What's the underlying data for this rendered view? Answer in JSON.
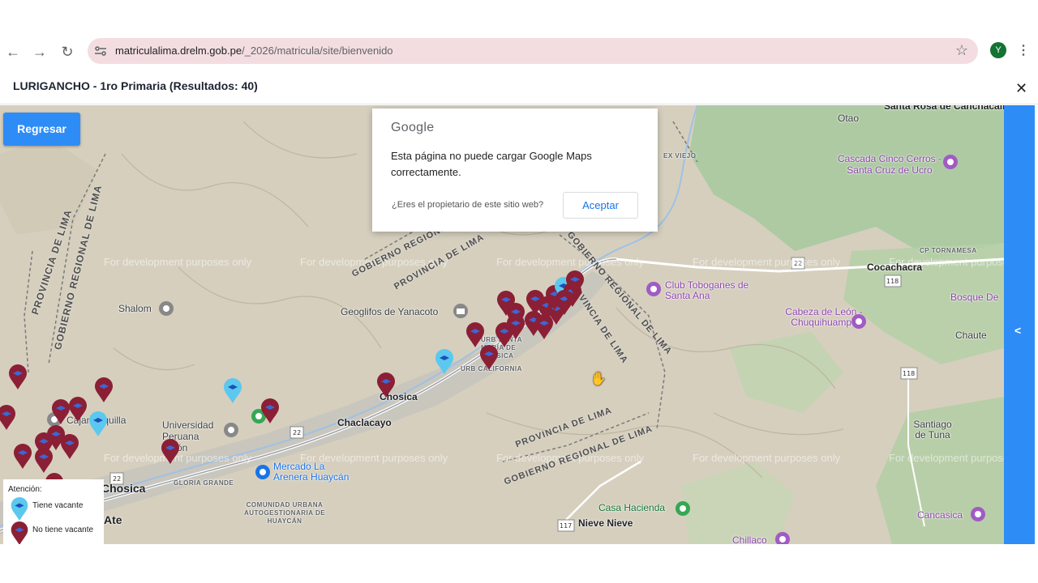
{
  "browser": {
    "url_domain": "matriculalima.drelm.gob.pe",
    "url_path": "/_2026/matricula/site/bienvenido",
    "avatar_letter": "Y"
  },
  "modal": {
    "title": "LURIGANCHO - 1ro Primaria (Resultados: 40)",
    "close_symbol": "✕"
  },
  "map": {
    "back_button": "Regresar",
    "side_toggle": "<",
    "watermark": "For development purposes only",
    "google_dialog": {
      "logo": "Google",
      "message": "Esta página no puede cargar Google Maps correctamente.",
      "owner_question": "¿Eres el propietario de este sitio web?",
      "accept_button": "Aceptar"
    },
    "legend": {
      "title": "Atención:",
      "vacancy": "Tiene vacante",
      "no_vacancy": "No tiene vacante"
    },
    "labels": {
      "santa_rosa": "Santa Rosa de Canchacalla",
      "otao": "Otao",
      "cascada": "Cascada Cinco Cerros - Santa Cruz de Ucro",
      "club_toboganes": "Club Toboganes de Santa Ana",
      "cocachacra": "Cocachacra",
      "cp_tornamesa": "CP TORNAMESA",
      "bosque": "Bosque De",
      "cabeza_leon": "Cabeza de León - Chuquihuampo",
      "chaute": "Chaute",
      "santiago_tuna": "Santiago de Tuna",
      "shalom": "Shalom",
      "geoglifos": "Geoglifos de Yanacoto",
      "chosica_center": "Chosica",
      "chaclacayo": "Chaclacayo",
      "universidad": "Universidad Peruana Unión",
      "cajamarquilla": "Cajamarquilla",
      "mercado": "Mercado La Arenera Huaycán",
      "chosica_left": "Chosica",
      "ate": "Ate",
      "gloria_grande": "GLORIA GRANDE",
      "comunidad": "COMUNIDAD URBANA AUTOGESTIONARIA DE HUAYCÁN",
      "casa_hacienda": "Casa Hacienda",
      "nieve_nieve": "Nieve Nieve",
      "cancasica": "Cancasica",
      "chillaco": "Chillaco",
      "urb_california": "URB CALIFORNIA",
      "santa_maria": "URB SANTA MARÍA DE CHOSICA",
      "ex_viejo": "EX VIEJO"
    },
    "boundaries": {
      "prov_lima": "PROVINCIA DE LIMA",
      "gob_regional": "GOBIERNO REGIONAL DE LIMA"
    },
    "road_numbers": [
      "22",
      "118",
      "117",
      "22"
    ],
    "colors": {
      "vacancy_pin": "#5bc8ef",
      "no_vacancy_pin": "#8b1f35",
      "accent": "#2e8cf6"
    }
  }
}
